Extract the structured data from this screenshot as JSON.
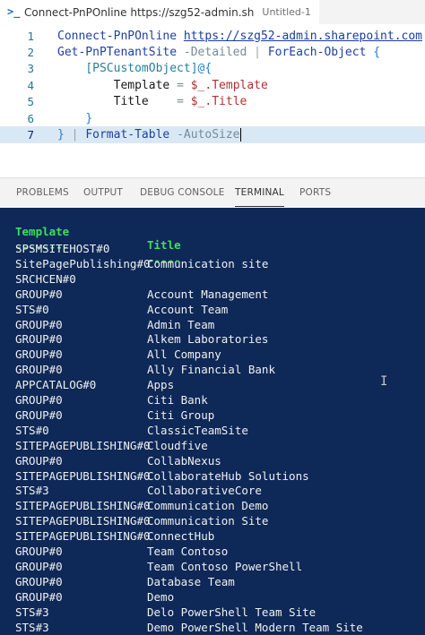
{
  "editor_tab": {
    "icon": "powershell-icon",
    "title": "Connect-PnPOnline https://szg52-admin.sh",
    "description": "Untitled-1"
  },
  "code": {
    "line_numbers": [
      "1",
      "2",
      "3",
      "4",
      "5",
      "6",
      "7"
    ],
    "l1_cmd": "Connect-PnPOnline",
    "l1_url": "https://szg52-admin.sharepoint.com",
    "l2_cmd": "Get-PnPTenantSite",
    "l2_param": "-Detailed",
    "l2_pipe": "|",
    "l2_cmd2": "ForEach-Object",
    "l2_brace": "{",
    "l3_type": "[PSCustomObject]",
    "l3_brace": "@{",
    "l4_key": "Template",
    "l4_eq": "=",
    "l4_val": "$_.Template",
    "l5_key": "Title",
    "l5_eq": "=",
    "l5_val": "$_.Title",
    "l6_brace": "}",
    "l7_brace": "}",
    "l7_pipe": "|",
    "l7_cmd": "Format-Table",
    "l7_param": "-AutoSize"
  },
  "panel_tabs": [
    "PROBLEMS",
    "OUTPUT",
    "DEBUG CONSOLE",
    "TERMINAL",
    "PORTS"
  ],
  "terminal": {
    "headers": [
      "Template",
      "Title"
    ],
    "underlines": [
      "--------",
      "-----"
    ],
    "rows": [
      [
        "SPSMSITEHOST#0",
        ""
      ],
      [
        "SitePagePublishing#0",
        "Communication site"
      ],
      [
        "SRCHCEN#0",
        ""
      ],
      [
        "GROUP#0",
        "Account Management"
      ],
      [
        "STS#0",
        "Account Team"
      ],
      [
        "GROUP#0",
        "Admin Team"
      ],
      [
        "GROUP#0",
        "Alkem Laboratories"
      ],
      [
        "GROUP#0",
        "All Company"
      ],
      [
        "GROUP#0",
        "Ally Financial Bank"
      ],
      [
        "APPCATALOG#0",
        "Apps"
      ],
      [
        "GROUP#0",
        "Citi Bank"
      ],
      [
        "GROUP#0",
        "Citi Group"
      ],
      [
        "STS#0",
        "ClassicTeamSite"
      ],
      [
        "SITEPAGEPUBLISHING#0",
        "Cloudfive"
      ],
      [
        "GROUP#0",
        "CollabNexus"
      ],
      [
        "SITEPAGEPUBLISHING#0",
        "CollaborateHub Solutions"
      ],
      [
        "STS#3",
        "CollaborativeCore"
      ],
      [
        "SITEPAGEPUBLISHING#0",
        "Communication Demo"
      ],
      [
        "SITEPAGEPUBLISHING#0",
        "Communication Site"
      ],
      [
        "SITEPAGEPUBLISHING#0",
        "ConnectHub"
      ],
      [
        "GROUP#0",
        "Team Contoso"
      ],
      [
        "GROUP#0",
        "Team Contoso PowerShell"
      ],
      [
        "GROUP#0",
        "Database Team"
      ],
      [
        "GROUP#0",
        "Demo"
      ],
      [
        "STS#3",
        "Delo PowerShell Team Site"
      ],
      [
        "STS#3",
        "Demo PowerShell Modern Team Site"
      ]
    ]
  }
}
